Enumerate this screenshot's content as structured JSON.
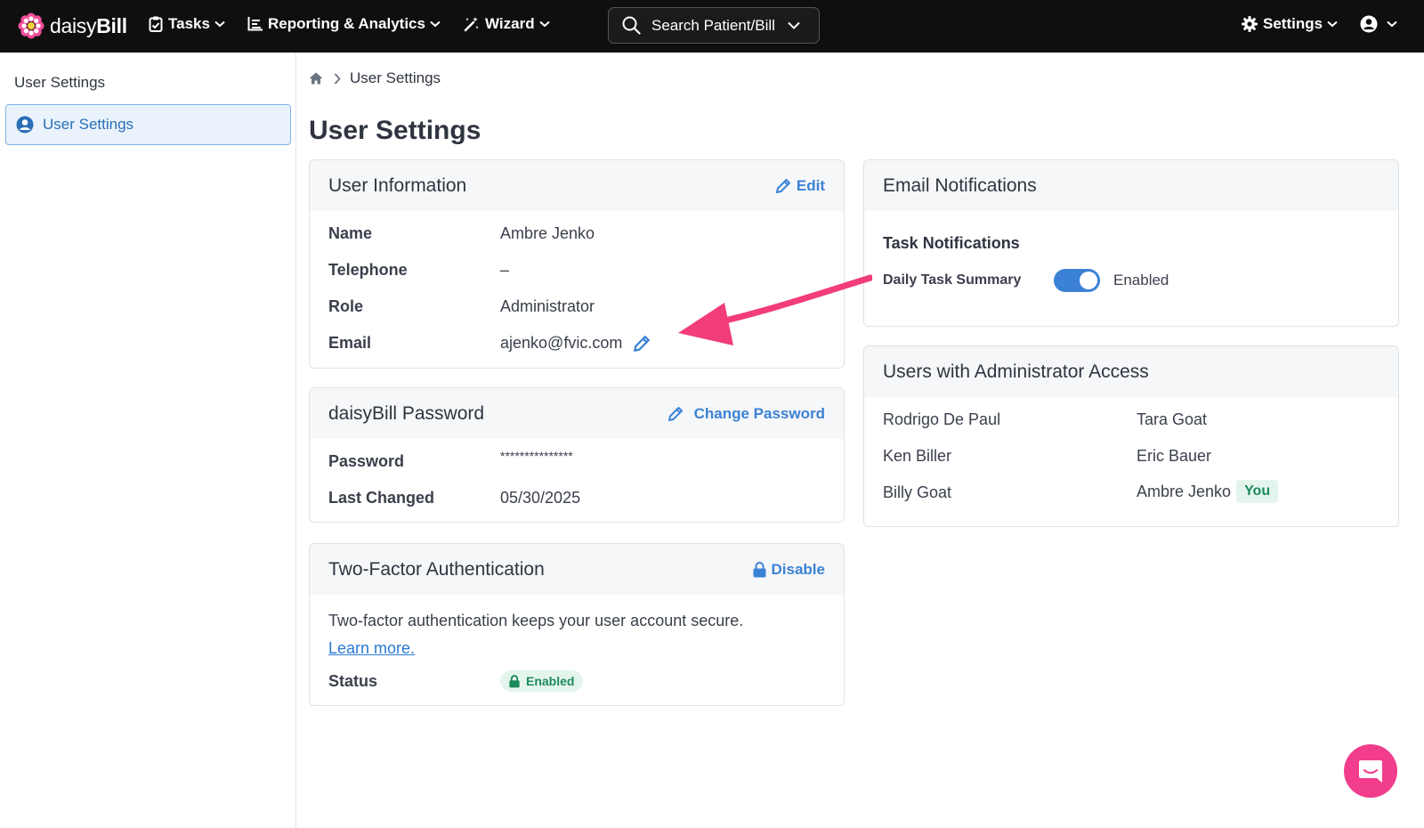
{
  "app": {
    "logo_prefix": "daisy",
    "logo_suffix": "Bill"
  },
  "nav": {
    "tasks": "Tasks",
    "reporting": "Reporting & Analytics",
    "wizard": "Wizard",
    "search_label": "Search Patient/Bill",
    "settings": "Settings"
  },
  "sidebar": {
    "title": "User Settings",
    "items": [
      {
        "label": "User Settings"
      }
    ]
  },
  "breadcrumb": {
    "current": "User Settings"
  },
  "page": {
    "title": "User Settings"
  },
  "user_info": {
    "title": "User Information",
    "edit_label": "Edit",
    "fields": [
      {
        "label": "Name",
        "value": "Ambre Jenko"
      },
      {
        "label": "Telephone",
        "value": "–"
      },
      {
        "label": "Role",
        "value": "Administrator"
      },
      {
        "label": "Email",
        "value": "ajenko@fvic.com"
      }
    ]
  },
  "password": {
    "title": "daisyBill Password",
    "change_label": "Change Password",
    "fields": [
      {
        "label": "Password",
        "value": "***************"
      },
      {
        "label": "Last Changed",
        "value": "05/30/2025"
      }
    ]
  },
  "two_factor": {
    "title": "Two-Factor Authentication",
    "disable_label": "Disable",
    "description": "Two-factor authentication keeps your user account secure.",
    "learn_more": "Learn more.",
    "status_label": "Status",
    "status_value": "Enabled"
  },
  "email_notifications": {
    "title": "Email Notifications",
    "subtitle": "Task Notifications",
    "toggle_label": "Daily Task Summary",
    "toggle_state": "Enabled"
  },
  "admins": {
    "title": "Users with Administrator Access",
    "names": [
      "Rodrigo De Paul",
      "Tara Goat",
      "Ken Biller",
      "Eric Bauer",
      "Billy Goat",
      "Ambre Jenko"
    ],
    "you_label": "You"
  },
  "colors": {
    "accent": "#3b82d6",
    "annotation_arrow": "#f23d78",
    "success": "#1d8a5a"
  }
}
